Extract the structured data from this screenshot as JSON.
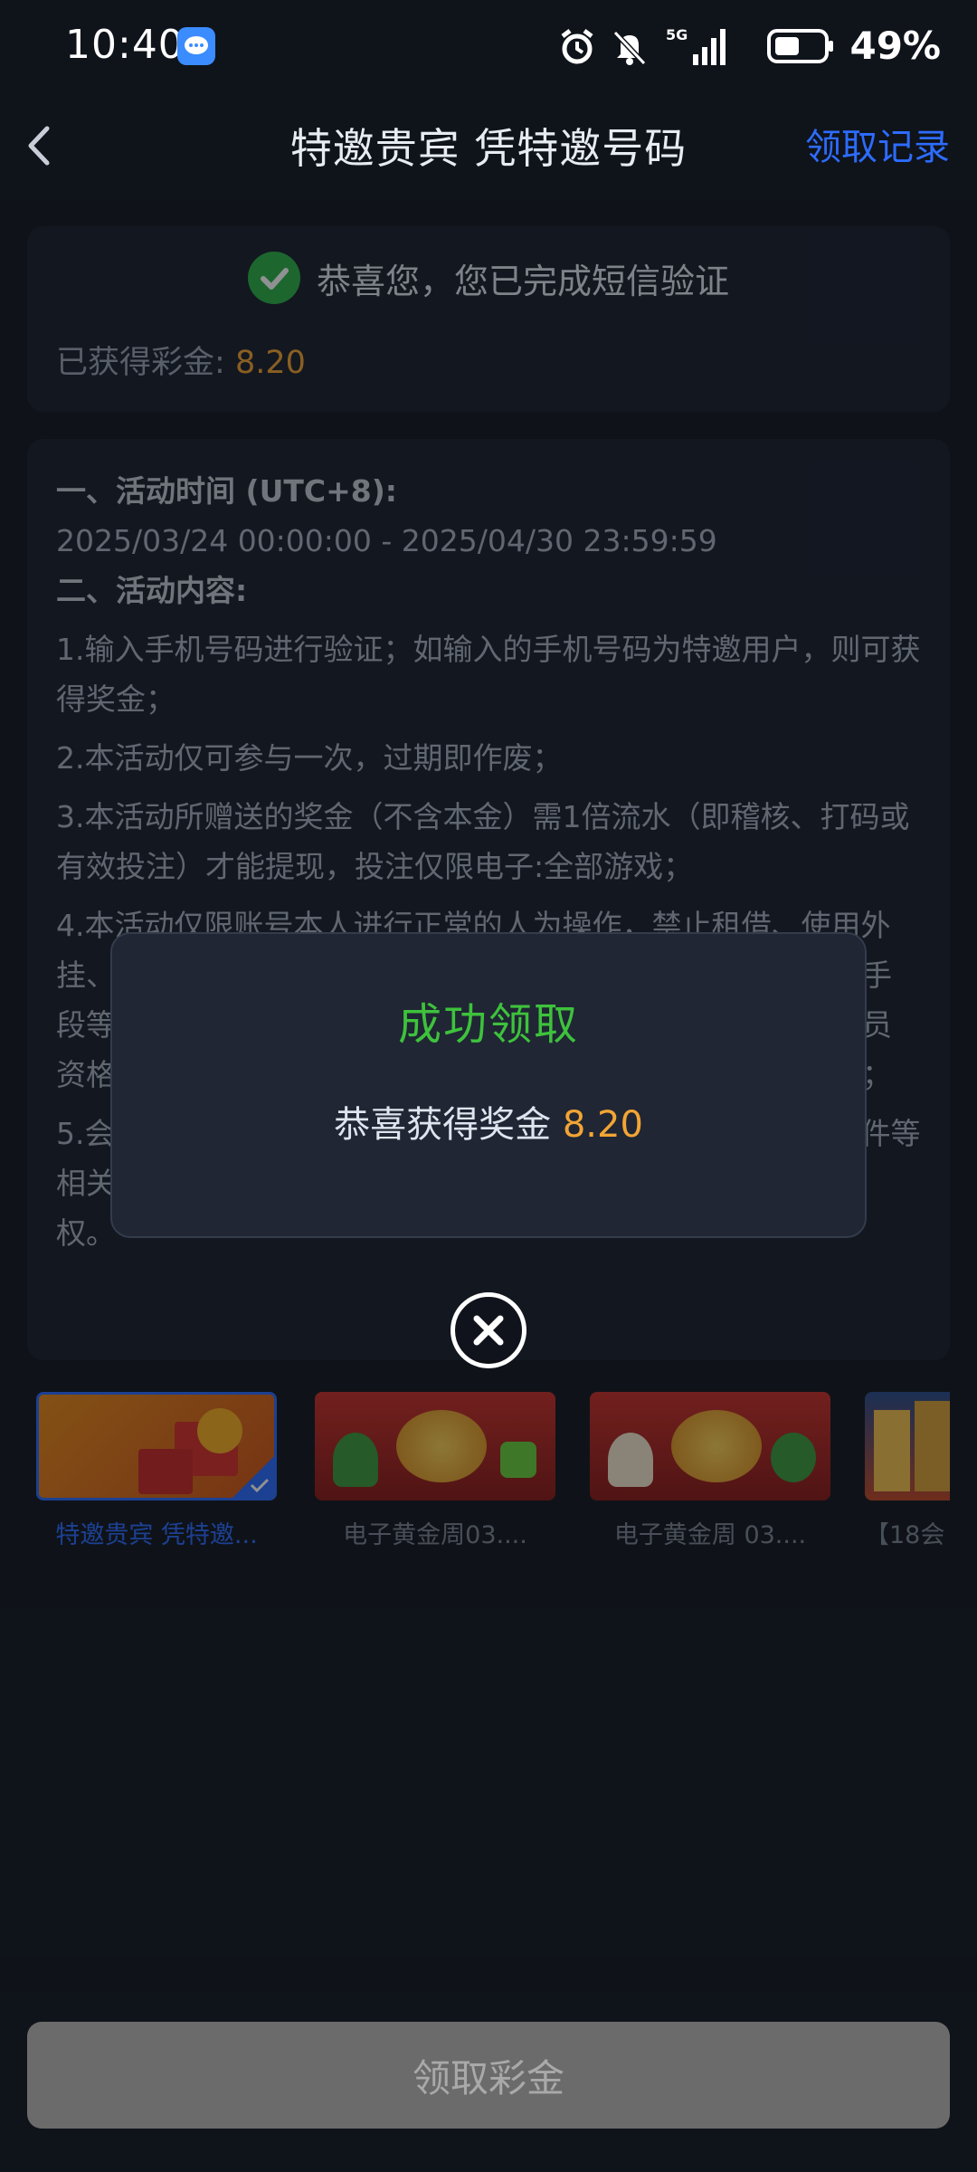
{
  "status": {
    "time": "10:40",
    "network": "5G",
    "battery": "49%"
  },
  "nav": {
    "title": "特邀贵宾 凭特邀号码",
    "records": "领取记录"
  },
  "success_card": {
    "message": "恭喜您，您已完成短信验证",
    "earned_label": "已获得彩金:",
    "earned_value": "8.20"
  },
  "rules": {
    "h1": "一、活动时间 (UTC+8):",
    "time_range": "2025/03/24 00:00:00 - 2025/04/30 23:59:59",
    "h2": "二、活动内容:",
    "items": [
      "1.输入手机号码进行验证；如输入的手机号码为特邀用户，则可获得奖金；",
      "2.本活动仅可参与一次，过期即作废；",
      "3.本活动所赠送的奖金（不含本金）需1倍流水（即稽核、打码或有效投注）才能提现，投注仅限电子:全部游戏；",
      "4.本活动仅限账号本人进行正常的人为操作，禁止租借、使用外挂、机器人、不同账号对赌、互刷、套利、接口、协议、技术手段等违规行为，一经查实将扣除奖励、冻结账号或永久暂停会员资格，平台有权对特殊账号进行核查，本活动不另行特别通知；",
      "5.会员领取活动奖励时，代表已同意并遵守活动条款、参与条件等相关规定，为避免文字理解歧义，本平台保有本活动最终解释权。"
    ]
  },
  "modal": {
    "title": "成功领取",
    "message": "恭喜获得奖金",
    "amount": "8.20"
  },
  "thumbnails": [
    {
      "label": "特邀贵宾 凭特邀...",
      "active": true
    },
    {
      "label": "电子黄金周03....",
      "active": false
    },
    {
      "label": "电子黄金周 03....",
      "active": false
    },
    {
      "label": "【18会",
      "active": false
    }
  ],
  "claim_button": "领取彩金",
  "colors": {
    "accent_blue": "#2d6cff",
    "gold": "#f3a534",
    "success_green": "#3ec23c"
  }
}
